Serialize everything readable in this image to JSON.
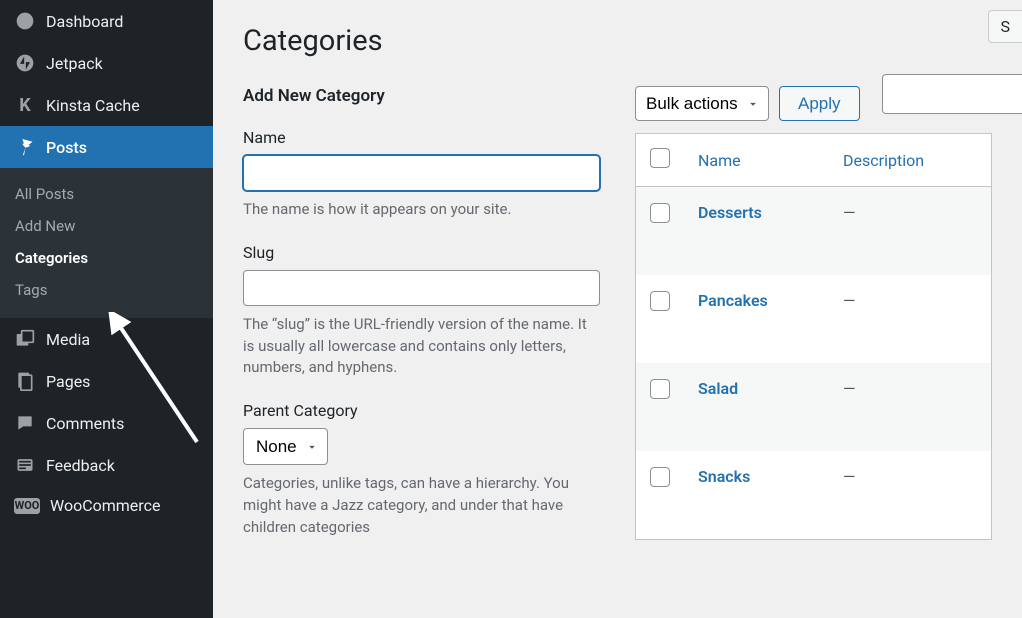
{
  "sidebar": {
    "dashboard": "Dashboard",
    "jetpack": "Jetpack",
    "kinsta": "Kinsta Cache",
    "posts": "Posts",
    "posts_sub": {
      "all": "All Posts",
      "add": "Add New",
      "categories": "Categories",
      "tags": "Tags"
    },
    "media": "Media",
    "pages": "Pages",
    "comments": "Comments",
    "feedback": "Feedback",
    "woocommerce": "WooCommerce"
  },
  "page": {
    "title": "Categories",
    "form_heading": "Add New Category",
    "name_label": "Name",
    "name_help": "The name is how it appears on your site.",
    "slug_label": "Slug",
    "slug_help": "The “slug” is the URL-friendly version of the name. It is usually all lowercase and contains only letters, numbers, and hyphens.",
    "parent_label": "Parent Category",
    "parent_value": "None",
    "parent_help": "Categories, unlike tags, can have a hierarchy. You might have a Jazz category, and under that have children categories"
  },
  "table": {
    "bulk_label": "Bulk actions",
    "apply_label": "Apply",
    "headers": {
      "name": "Name",
      "description": "Description"
    },
    "rows": [
      {
        "name": "Desserts",
        "description": "—"
      },
      {
        "name": "Pancakes",
        "description": "—"
      },
      {
        "name": "Salad",
        "description": "—"
      },
      {
        "name": "Snacks",
        "description": "—"
      }
    ]
  },
  "search_btn_char": "S"
}
